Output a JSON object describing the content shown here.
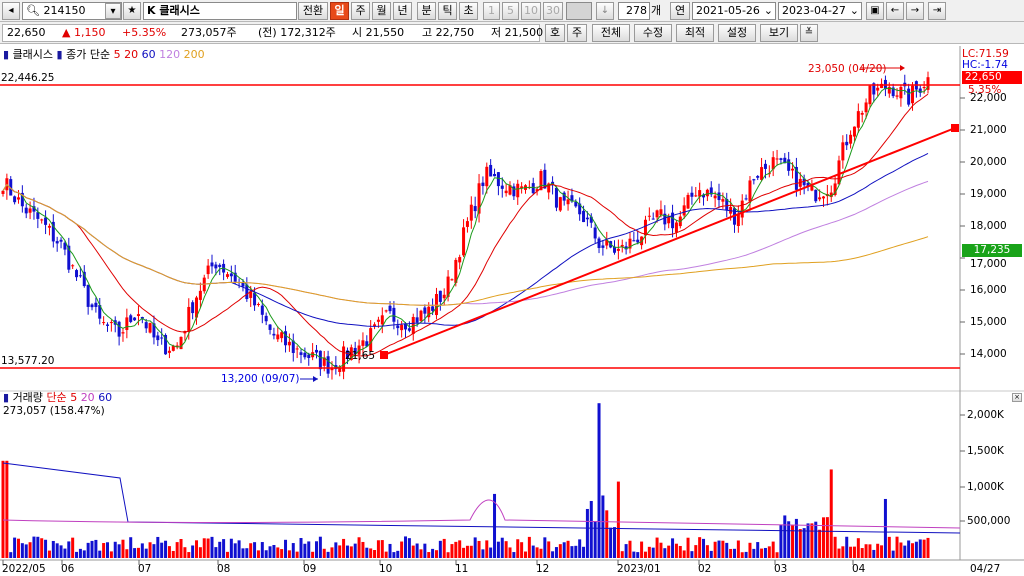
{
  "toolbar": {
    "code": "214150",
    "name": "K 클래시스",
    "mode_label": "전환",
    "periods": [
      "일",
      "주",
      "월",
      "년",
      "분",
      "틱",
      "초"
    ],
    "selected_period": "일",
    "minute_presets": [
      "1",
      "5",
      "10",
      "30"
    ],
    "count": "278",
    "count_unit": "개",
    "date_type": "연",
    "start_date": "2021-05-26",
    "end_date": "2023-04-27"
  },
  "quote": {
    "price": "22,650",
    "change": "▲ 1,150",
    "change_pct": "+5.35%",
    "volume": "273,057주",
    "prev_volume": "(전) 172,312주",
    "open": "시 21,550",
    "high": "고 22,750",
    "low": "저 21,500"
  },
  "toolbar2": {
    "buttons": [
      "호",
      "주",
      "전체",
      "수정",
      "최적",
      "설정",
      "보기"
    ]
  },
  "price_panel": {
    "legend_name": "클래시스",
    "legend_series": "종가 단순",
    "ma_periods": [
      {
        "label": "5",
        "color": "#e00000"
      },
      {
        "label": "20",
        "color": "#e00000"
      },
      {
        "label": "60",
        "color": "#1010c0"
      },
      {
        "label": "120",
        "color": "#c080e0"
      },
      {
        "label": "200",
        "color": "#e0a020"
      }
    ],
    "hline_high": "22,446.25",
    "hline_low": "13,577.20",
    "low_annotation": "13,200 (09/07)",
    "high_annotation": "23,050 (04/20)",
    "trend_label": "21,65",
    "lc": "LC:71.59",
    "hc": "HC:-1.74",
    "current_price": "22,650",
    "current_pct": "5.35%",
    "ma_value_tag": "17,235",
    "y_ticks": [
      "22,000",
      "21,000",
      "20,000",
      "19,000",
      "18,000",
      "17,000",
      "16,000",
      "15,000",
      "14,000"
    ]
  },
  "volume_panel": {
    "legend_name": "거래량",
    "legend_series": "단순",
    "ma_periods": [
      {
        "label": "5",
        "color": "#e00000"
      },
      {
        "label": "20",
        "color": "#c040c0"
      },
      {
        "label": "60",
        "color": "#1010c0"
      }
    ],
    "value": "273,057 (158.47%)",
    "y_ticks": [
      "2,000K",
      "1,500K",
      "1,000K",
      "500,000"
    ]
  },
  "x_axis": {
    "labels": [
      "2022/05",
      "06",
      "07",
      "08",
      "09",
      "10",
      "11",
      "12",
      "2023/01",
      "02",
      "03",
      "04"
    ],
    "end_label": "04/27"
  },
  "chart_data": {
    "type": "candlestick",
    "x_range": [
      "2022-05-02",
      "2023-04-27"
    ],
    "ylim": [
      13000,
      23400
    ],
    "price_path_close": [
      19400,
      18600,
      18100,
      17400,
      16200,
      15000,
      14600,
      15400,
      14300,
      14200,
      15800,
      16900,
      16400,
      15600,
      14600,
      14200,
      13900,
      13600,
      14100,
      14500,
      15200,
      15000,
      15300,
      16000,
      17900,
      19600,
      19300,
      19100,
      19500,
      18600,
      18400,
      17400,
      17200,
      17700,
      18300,
      18100,
      19200,
      18900,
      18300,
      19600,
      20000,
      19500,
      19000,
      19300,
      21100,
      22100,
      22400,
      22000,
      22650
    ],
    "volume_peak": "≈2,150K (2022/11)",
    "moving_averages": [
      "5",
      "20",
      "60",
      "120",
      "200"
    ]
  }
}
